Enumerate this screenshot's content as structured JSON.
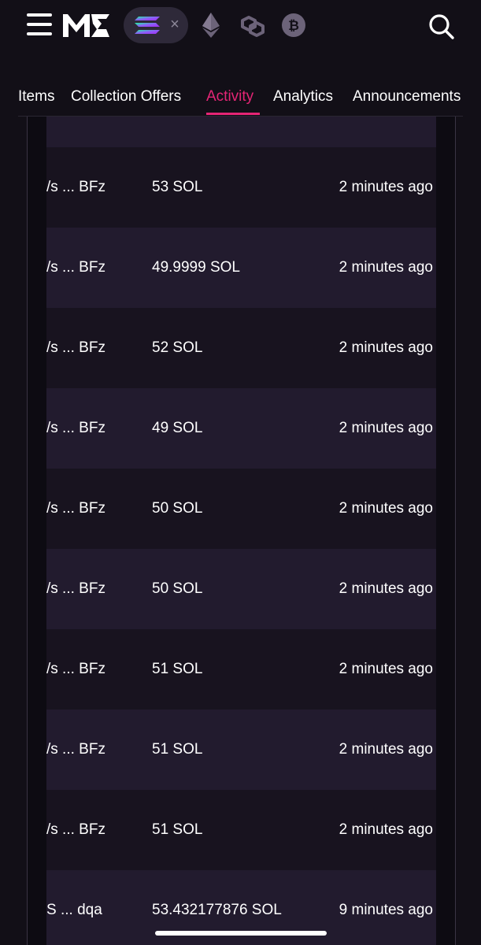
{
  "header": {
    "menu_icon": "hamburger-menu-icon",
    "logo_icon": "magic-eden-logo-icon",
    "chains": [
      {
        "name": "solana",
        "icon": "solana-icon",
        "selected": true
      },
      {
        "name": "ethereum",
        "icon": "ethereum-icon"
      },
      {
        "name": "polygon",
        "icon": "polygon-icon"
      },
      {
        "name": "bitcoin",
        "icon": "bitcoin-icon"
      }
    ],
    "close_glyph": "×",
    "search_icon": "search-icon"
  },
  "tabs": [
    {
      "label": "Items"
    },
    {
      "label": "Collection Offers"
    },
    {
      "label": "Activity",
      "active": true
    },
    {
      "label": "Analytics"
    },
    {
      "label": "Announcements"
    }
  ],
  "activity": {
    "rows": [
      {
        "buyer": "",
        "price": "",
        "time": ""
      },
      {
        "buyer": "/s ... BFz",
        "price": "53 SOL",
        "time": "2 minutes ago"
      },
      {
        "buyer": "/s ... BFz",
        "price": "49.9999 SOL",
        "time": "2 minutes ago"
      },
      {
        "buyer": "/s ... BFz",
        "price": "52 SOL",
        "time": "2 minutes ago"
      },
      {
        "buyer": "/s ... BFz",
        "price": "49 SOL",
        "time": "2 minutes ago"
      },
      {
        "buyer": "/s ... BFz",
        "price": "50 SOL",
        "time": "2 minutes ago"
      },
      {
        "buyer": "/s ... BFz",
        "price": "50 SOL",
        "time": "2 minutes ago"
      },
      {
        "buyer": "/s ... BFz",
        "price": "51 SOL",
        "time": "2 minutes ago"
      },
      {
        "buyer": "/s ... BFz",
        "price": "51 SOL",
        "time": "2 minutes ago"
      },
      {
        "buyer": "/s ... BFz",
        "price": "51 SOL",
        "time": "2 minutes ago"
      },
      {
        "buyer": "S ... dqa",
        "price": "53.432177876 SOL",
        "time": "9 minutes ago"
      }
    ]
  },
  "colors": {
    "background": "#120f17",
    "accent": "#e42575",
    "row_odd": "#221b2e",
    "row_even": "#18131f"
  }
}
